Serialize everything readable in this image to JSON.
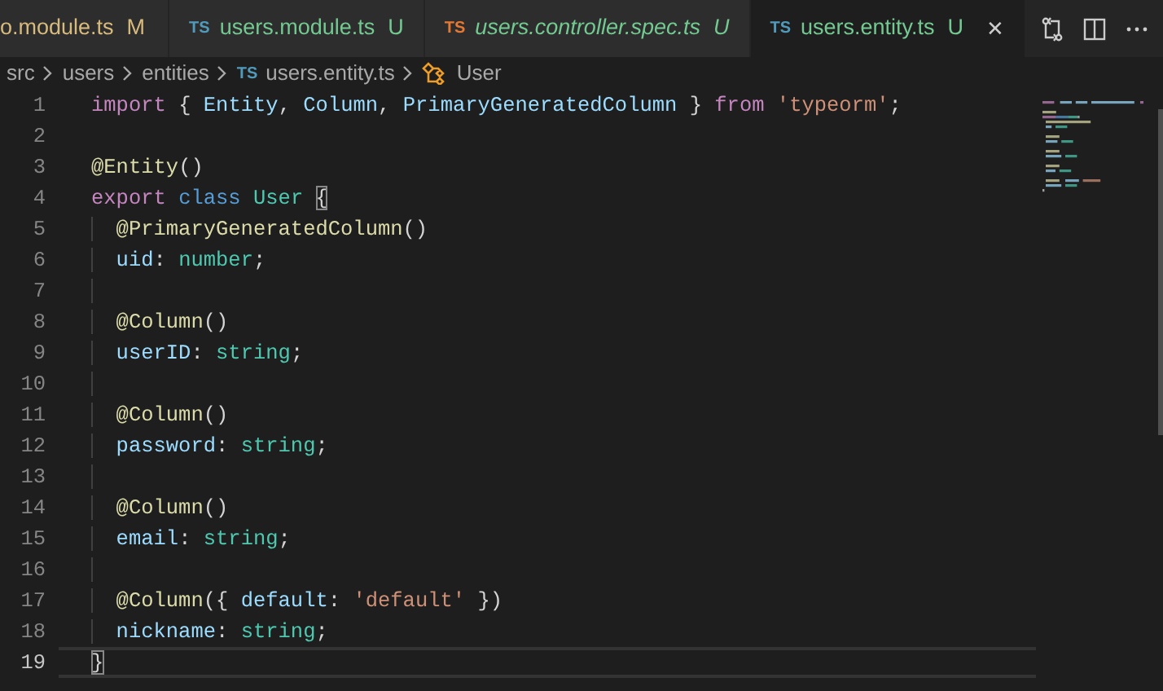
{
  "tabs": [
    {
      "kind": "modified",
      "label": "o.module.ts",
      "status": "M",
      "preview": false,
      "selected": false
    },
    {
      "kind": "untracked",
      "icon": "TS",
      "color": "#519aba",
      "label": "users.module.ts",
      "status": "U",
      "preview": false,
      "selected": false
    },
    {
      "kind": "untracked",
      "icon": "TS",
      "color": "#e37933",
      "label": "users.controller.spec.ts",
      "status": "U",
      "preview": true,
      "selected": false
    },
    {
      "kind": "untracked",
      "icon": "TS",
      "color": "#519aba",
      "label": "users.entity.ts",
      "status": "U",
      "preview": false,
      "selected": true,
      "close": "✕"
    }
  ],
  "breadcrumb": [
    {
      "kind": "folder",
      "label": "src"
    },
    {
      "kind": "folder",
      "label": "users"
    },
    {
      "kind": "folder",
      "label": "entities"
    },
    {
      "kind": "file",
      "icon": "TS",
      "label": "users.entity.ts"
    },
    {
      "kind": "symbol",
      "label": "User"
    }
  ],
  "lines": [
    {
      "number": "1",
      "current": false,
      "tokens": [
        {
          "kind": "keyword",
          "text": "import"
        },
        {
          "kind": "punct",
          "text": " { "
        },
        {
          "kind": "variable",
          "text": "Entity"
        },
        {
          "kind": "punct",
          "text": ", "
        },
        {
          "kind": "variable",
          "text": "Column"
        },
        {
          "kind": "punct",
          "text": ", "
        },
        {
          "kind": "variable",
          "text": "PrimaryGeneratedColumn"
        },
        {
          "kind": "punct",
          "text": " } "
        },
        {
          "kind": "keyword",
          "text": "from "
        },
        {
          "kind": "string",
          "text": "'typeorm'"
        },
        {
          "kind": "punct",
          "text": ";"
        }
      ]
    },
    {
      "number": "2",
      "current": false
    },
    {
      "number": "3",
      "current": false,
      "tokens": [
        {
          "kind": "decorator",
          "text": "@Entity"
        },
        {
          "kind": "punct",
          "text": "()"
        }
      ]
    },
    {
      "number": "4",
      "current": false,
      "tokens": [
        {
          "kind": "keyword",
          "text": "export "
        },
        {
          "kind": "storage",
          "text": "class "
        },
        {
          "kind": "type",
          "text": "User "
        },
        {
          "kind": "bracket-match",
          "text": "{"
        }
      ],
      "children": [
        {
          "number": "5",
          "current": false,
          "tokens": [
            {
              "kind": "decorator",
              "text": "@PrimaryGeneratedColumn"
            },
            {
              "kind": "punct",
              "text": "()"
            }
          ]
        },
        {
          "number": "6",
          "current": false,
          "tokens": [
            {
              "kind": "variable",
              "text": "uid"
            },
            {
              "kind": "punct",
              "text": ": "
            },
            {
              "kind": "type",
              "text": "number"
            },
            {
              "kind": "punct",
              "text": ";"
            }
          ]
        },
        {
          "number": "7",
          "current": false
        },
        {
          "number": "8",
          "current": false,
          "tokens": [
            {
              "kind": "decorator",
              "text": "@Column"
            },
            {
              "kind": "punct",
              "text": "()"
            }
          ]
        },
        {
          "number": "9",
          "current": false,
          "tokens": [
            {
              "kind": "variable",
              "text": "userID"
            },
            {
              "kind": "punct",
              "text": ": "
            },
            {
              "kind": "type",
              "text": "string"
            },
            {
              "kind": "punct",
              "text": ";"
            }
          ]
        },
        {
          "number": "10",
          "current": false
        },
        {
          "number": "11",
          "current": false,
          "tokens": [
            {
              "kind": "decorator",
              "text": "@Column"
            },
            {
              "kind": "punct",
              "text": "()"
            }
          ]
        },
        {
          "number": "12",
          "current": false,
          "tokens": [
            {
              "kind": "variable",
              "text": "password"
            },
            {
              "kind": "punct",
              "text": ": "
            },
            {
              "kind": "type",
              "text": "string"
            },
            {
              "kind": "punct",
              "text": ";"
            }
          ]
        },
        {
          "number": "13",
          "current": false
        },
        {
          "number": "14",
          "current": false,
          "tokens": [
            {
              "kind": "decorator",
              "text": "@Column"
            },
            {
              "kind": "punct",
              "text": "()"
            }
          ]
        },
        {
          "number": "15",
          "current": false,
          "tokens": [
            {
              "kind": "variable",
              "text": "email"
            },
            {
              "kind": "punct",
              "text": ": "
            },
            {
              "kind": "type",
              "text": "string"
            },
            {
              "kind": "punct",
              "text": ";"
            }
          ]
        },
        {
          "number": "16",
          "current": false
        },
        {
          "number": "17",
          "current": false,
          "tokens": [
            {
              "kind": "decorator",
              "text": "@Column"
            },
            {
              "kind": "punct",
              "text": "({ "
            },
            {
              "kind": "variable",
              "text": "default"
            },
            {
              "kind": "punct",
              "text": ": "
            },
            {
              "kind": "string",
              "text": "'default'"
            },
            {
              "kind": "punct",
              "text": " })"
            }
          ]
        },
        {
          "number": "18",
          "current": false,
          "tokens": [
            {
              "kind": "variable",
              "text": "nickname"
            },
            {
              "kind": "punct",
              "text": ": "
            },
            {
              "kind": "type",
              "text": "string"
            },
            {
              "kind": "punct",
              "text": ";"
            }
          ]
        }
      ]
    },
    {
      "number": "19",
      "current": true,
      "tokens": [
        {
          "kind": "bracket-match",
          "text": "}"
        }
      ]
    }
  ]
}
